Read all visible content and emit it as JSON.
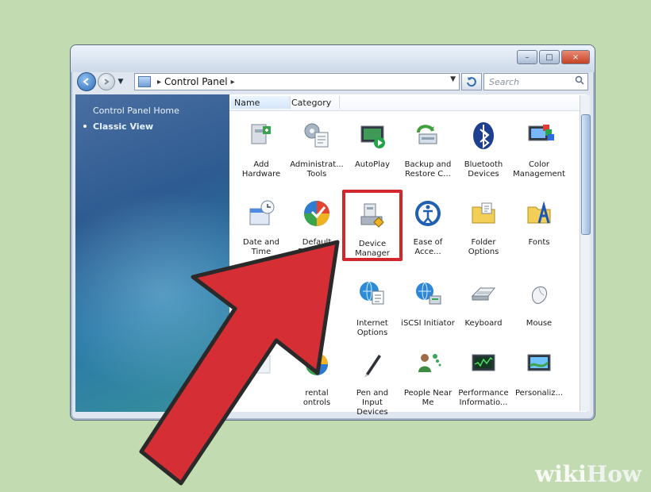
{
  "window": {
    "controls": [
      "–",
      "□",
      "×"
    ]
  },
  "address_bar": {
    "separator": "▸",
    "path": "Control Panel",
    "trail_separator": "▸"
  },
  "search": {
    "placeholder": "Search"
  },
  "left_pane": {
    "home": "Control Panel Home",
    "classic": "Classic View"
  },
  "columns": {
    "name": "Name",
    "category": "Category"
  },
  "items": [
    {
      "label": "Add\nHardware",
      "icon": "add-hardware-icon"
    },
    {
      "label": "Administrat...\nTools",
      "icon": "administrative-tools-icon"
    },
    {
      "label": "AutoPlay",
      "icon": "autoplay-icon"
    },
    {
      "label": "Backup and\nRestore C...",
      "icon": "backup-restore-icon"
    },
    {
      "label": "Bluetooth\nDevices",
      "icon": "bluetooth-icon"
    },
    {
      "label": "Color\nManagement",
      "icon": "color-management-icon"
    },
    {
      "label": "Date and\nTime",
      "icon": "date-time-icon"
    },
    {
      "label": "Default\nPrograms",
      "icon": "default-programs-icon"
    },
    {
      "label": "Device\nManager",
      "icon": "device-manager-icon",
      "selected": true
    },
    {
      "label": "Ease of\nAcce...",
      "icon": "ease-of-access-icon"
    },
    {
      "label": "Folder\nOptions",
      "icon": "folder-options-icon"
    },
    {
      "label": "Fonts",
      "icon": "fonts-icon"
    },
    {
      "label": "",
      "icon": "globe-icon"
    },
    {
      "label": "",
      "icon": "hidden-icon"
    },
    {
      "label": "Internet\nOptions",
      "icon": "internet-options-icon"
    },
    {
      "label": "iSCSI Initiator",
      "icon": "iscsi-icon"
    },
    {
      "label": "Keyboard",
      "icon": "keyboard-icon"
    },
    {
      "label": "Mouse",
      "icon": "mouse-icon"
    },
    {
      "label": "",
      "icon": "hidden-icon"
    },
    {
      "label": "rental\nontrols",
      "icon": "parental-controls-icon"
    },
    {
      "label": "Pen and\nInput Devices",
      "icon": "pen-input-icon"
    },
    {
      "label": "People Near\nMe",
      "icon": "people-near-me-icon"
    },
    {
      "label": "Performance\nInformatio...",
      "icon": "performance-icon"
    },
    {
      "label": "Personaliz...",
      "icon": "personalization-icon"
    }
  ],
  "colors": {
    "highlight": "#d5262d",
    "arrow": "#d52f35"
  },
  "watermark": {
    "wiki": "wiki",
    "how": "How"
  }
}
